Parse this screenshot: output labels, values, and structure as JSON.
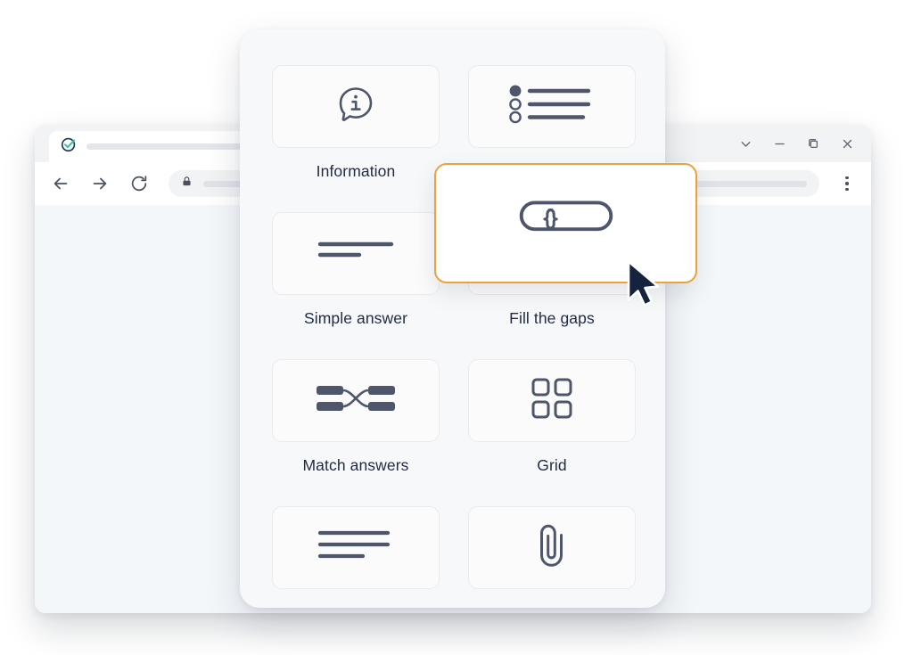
{
  "browser": {
    "tab": {
      "favicon": "check-circle-favicon",
      "title": ""
    },
    "window_controls": [
      {
        "name": "chevron-down-icon",
        "label": ""
      },
      {
        "name": "minimize-icon",
        "label": ""
      },
      {
        "name": "maximize-icon",
        "label": ""
      },
      {
        "name": "close-icon",
        "label": ""
      }
    ],
    "toolbar": {
      "back": "back-arrow-icon",
      "forward": "forward-arrow-icon",
      "reload": "reload-icon",
      "lock": "lock-icon",
      "address_value": "",
      "address_placeholder": "",
      "menu": "kebab-menu-icon"
    }
  },
  "picker": {
    "title": "",
    "items": [
      {
        "label": "Information",
        "icon": "info-bubble-icon",
        "selected": false
      },
      {
        "label": "",
        "icon": "radio-list-icon",
        "selected": false
      },
      {
        "label": "Simple answer",
        "icon": "short-lines-icon",
        "selected": false
      },
      {
        "label": "Fill the gaps",
        "icon": "text-input-icon",
        "selected": true
      },
      {
        "label": "Match answers",
        "icon": "match-pairs-icon",
        "selected": false
      },
      {
        "label": "Grid",
        "icon": "grid-icon",
        "selected": false
      },
      {
        "label": "",
        "icon": "paragraph-icon",
        "selected": false
      },
      {
        "label": "",
        "icon": "paperclip-icon",
        "selected": false
      }
    ],
    "highlight": {
      "icon": "text-input-icon",
      "label": "Fill the gaps",
      "border_color": "#e8a33d"
    },
    "cursor": {
      "icon": "mouse-pointer-icon"
    }
  },
  "colors": {
    "icon": "#4d566b",
    "text": "#1f2a44",
    "highlight_border": "#e8a33d",
    "panel_bg": "#f7f8f9",
    "tile_bg": "#fbfbfc",
    "browser_content_bg": "#f4f7fa",
    "favicon_ring": "#1f3a63",
    "favicon_check": "#2fc98f"
  }
}
